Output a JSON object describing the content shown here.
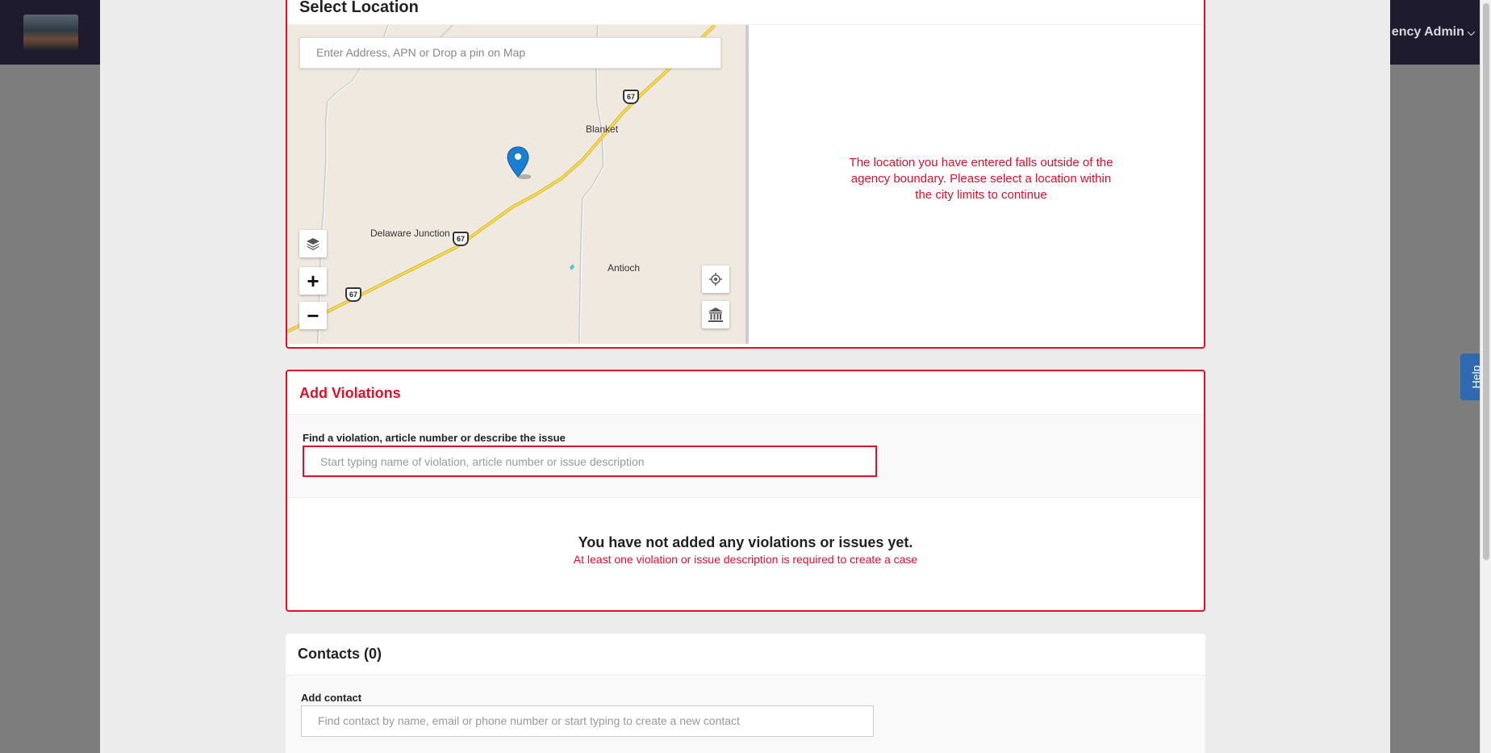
{
  "header": {
    "user_menu_label": "ency Admin",
    "chevron": "⌵"
  },
  "help": {
    "label": "Help"
  },
  "location": {
    "title": "Select Location",
    "search_placeholder": "Enter Address, APN or Drop a pin on Map",
    "map_labels": {
      "blanket": "Blanket",
      "delaware_junction": "Delaware Junction",
      "antioch": "Antioch"
    },
    "highway_shields": [
      "67",
      "67",
      "67"
    ],
    "zoom_in": "+",
    "zoom_out": "−",
    "error_message": "The location you have entered falls outside of the agency boundary. Please select a location within the city limits to continue",
    "colors": {
      "error": "#e0102a",
      "road": "#f2d43b",
      "pin": "#1a7fd0"
    }
  },
  "violations": {
    "title": "Add Violations",
    "field_label": "Find a violation, article number or describe the issue",
    "search_placeholder": "Start typing name of violation, article number or issue description",
    "empty_title": "You have not added any violations or issues yet.",
    "empty_subtitle": "At least one violation or issue description is required to create a case"
  },
  "contacts": {
    "title": "Contacts (0)",
    "field_label": "Add contact",
    "search_placeholder": "Find contact by name, email or phone number or start typing to create a new contact"
  }
}
